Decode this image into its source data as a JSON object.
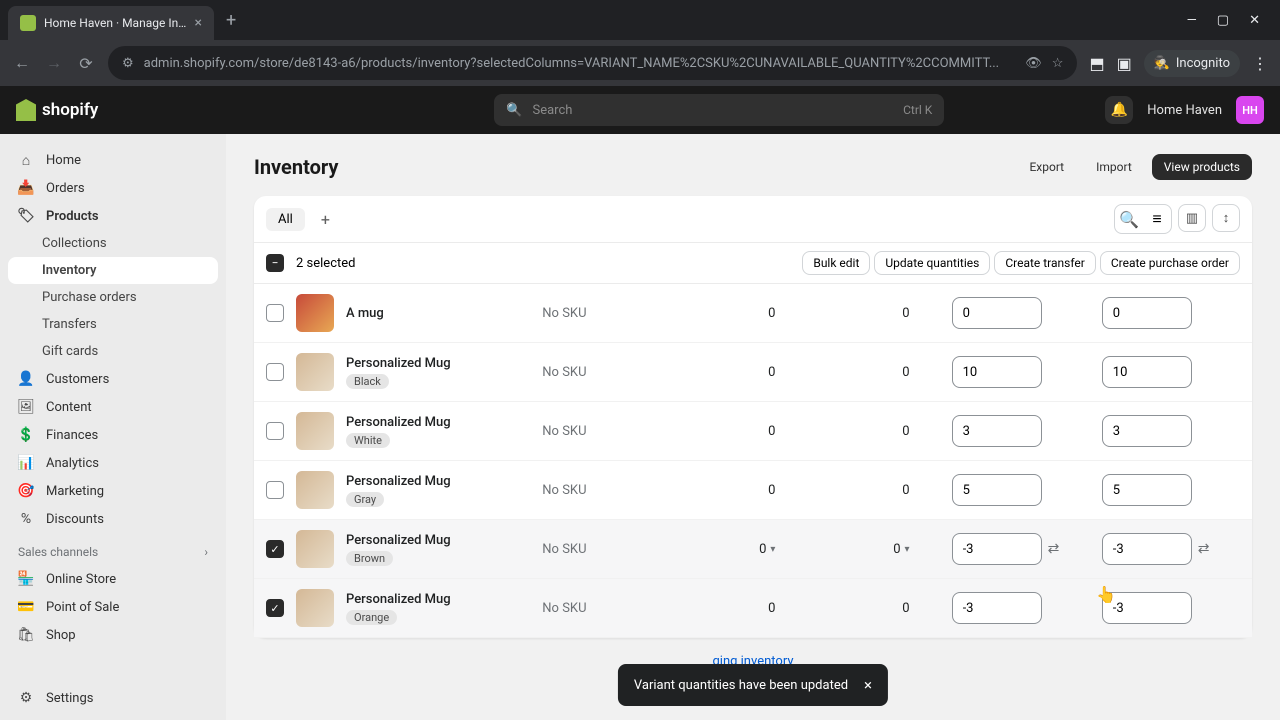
{
  "browser": {
    "tab_title": "Home Haven · Manage Invento",
    "url": "admin.shopify.com/store/de8143-a6/products/inventory?selectedColumns=VARIANT_NAME%2CSKU%2CUNAVAILABLE_QUANTITY%2CCOMMITT...",
    "incognito": "Incognito"
  },
  "topbar": {
    "logo": "shopify",
    "search_placeholder": "Search",
    "search_shortcut": "Ctrl K",
    "store_name": "Home Haven",
    "avatar": "HH"
  },
  "sidebar": {
    "home": "Home",
    "orders": "Orders",
    "products": "Products",
    "collections": "Collections",
    "inventory": "Inventory",
    "purchase_orders": "Purchase orders",
    "transfers": "Transfers",
    "gift_cards": "Gift cards",
    "customers": "Customers",
    "content": "Content",
    "finances": "Finances",
    "analytics": "Analytics",
    "marketing": "Marketing",
    "discounts": "Discounts",
    "sales_channels": "Sales channels",
    "online_store": "Online Store",
    "point_of_sale": "Point of Sale",
    "shop": "Shop",
    "settings": "Settings"
  },
  "page": {
    "title": "Inventory",
    "export": "Export",
    "import": "Import",
    "view_products": "View products",
    "all_tab": "All",
    "selected_text": "2 selected",
    "bulk_edit": "Bulk edit",
    "update_quantities": "Update quantities",
    "create_transfer": "Create transfer",
    "create_po": "Create purchase order",
    "footer_link": "ging inventory"
  },
  "rows": [
    {
      "checked": false,
      "product": "A mug",
      "variant": "",
      "sku": "No SKU",
      "unavailable": "0",
      "committed": "0",
      "available": "0",
      "onhand": "0",
      "thumb": "mug1",
      "hover": false
    },
    {
      "checked": false,
      "product": "Personalized Mug",
      "variant": "Black",
      "sku": "No SKU",
      "unavailable": "0",
      "committed": "0",
      "available": "10",
      "onhand": "10",
      "thumb": "",
      "hover": false
    },
    {
      "checked": false,
      "product": "Personalized Mug",
      "variant": "White",
      "sku": "No SKU",
      "unavailable": "0",
      "committed": "0",
      "available": "3",
      "onhand": "3",
      "thumb": "",
      "hover": false
    },
    {
      "checked": false,
      "product": "Personalized Mug",
      "variant": "Gray",
      "sku": "No SKU",
      "unavailable": "0",
      "committed": "0",
      "available": "5",
      "onhand": "5",
      "thumb": "",
      "hover": false
    },
    {
      "checked": true,
      "product": "Personalized Mug",
      "variant": "Brown",
      "sku": "No SKU",
      "unavailable": "0",
      "committed": "0",
      "available": "-3",
      "onhand": "-3",
      "thumb": "",
      "hover": true
    },
    {
      "checked": true,
      "product": "Personalized Mug",
      "variant": "Orange",
      "sku": "No SKU",
      "unavailable": "0",
      "committed": "0",
      "available": "-3",
      "onhand": "-3",
      "thumb": "",
      "hover": false
    }
  ],
  "toast": {
    "message": "Variant quantities have been updated"
  }
}
